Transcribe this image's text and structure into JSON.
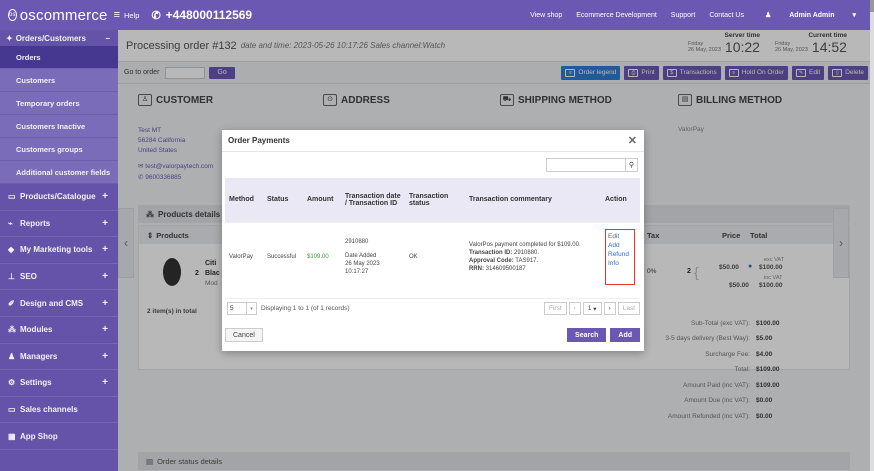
{
  "topbar": {
    "logo": "oscommerce",
    "help": "Help",
    "phone": "+448000112569",
    "links": [
      "View shop",
      "Ecommerce Development",
      "Support",
      "Contact Us"
    ],
    "admin": "Admin Admin"
  },
  "sidebar": {
    "section": "Orders/Customers",
    "sub_items": [
      {
        "label": "Orders",
        "active": true
      },
      {
        "label": "Customers",
        "active": false
      },
      {
        "label": "Temporary orders",
        "active": false
      },
      {
        "label": "Customers Inactive",
        "active": false
      },
      {
        "label": "Customers groups",
        "active": false
      },
      {
        "label": "Additional customer fields",
        "active": false
      }
    ],
    "main_items": [
      {
        "label": "Products/Catalogue",
        "icon": "catalogue-icon"
      },
      {
        "label": "Reports",
        "icon": "chart-icon"
      },
      {
        "label": "My Marketing tools",
        "icon": "marketing-icon"
      },
      {
        "label": "SEO",
        "icon": "seo-icon"
      },
      {
        "label": "Design and CMS",
        "icon": "brush-icon"
      },
      {
        "label": "Modules",
        "icon": "modules-icon"
      },
      {
        "label": "Managers",
        "icon": "managers-icon"
      },
      {
        "label": "Settings",
        "icon": "settings-icon"
      },
      {
        "label": "Sales channels",
        "icon": "sales-icon"
      },
      {
        "label": "App Shop",
        "icon": "app-shop-icon"
      }
    ]
  },
  "header": {
    "title": "Processing order #132",
    "subtitle": "date and time: 2023-05-26 10:17:26  Sales channel:Watch",
    "server_label": "Server time",
    "server_day": "Friday",
    "server_date": "26 May, 2023",
    "server_time": "10:22",
    "current_label": "Current time",
    "current_day": "Friday",
    "current_date": "26 May, 2023",
    "current_time": "14:52"
  },
  "toolbar": {
    "go_label": "Go to order",
    "go_button": "Go",
    "buttons": [
      "Order legend",
      "Print",
      "Transactions",
      "Hold On Order",
      "Edit",
      "Delete"
    ]
  },
  "sections": {
    "customer": "CUSTOMER",
    "address": "ADDRESS",
    "shipping": "SHIPPING METHOD",
    "billing": "BILLING METHOD",
    "billing_value": "ValorPay",
    "customer_lines": [
      "Test MT",
      "56284 California",
      "United States",
      "test@valorpaytech.com",
      "9600336885"
    ]
  },
  "products": {
    "panel_title": "Products details",
    "header": "Products",
    "tax_header": "Tax",
    "price_header": "Price",
    "total_header": "Total",
    "product_short": "Citi",
    "qty": "2",
    "qty_name": "Blac",
    "model": "Mod",
    "tax": "0%",
    "qty_right": "2",
    "exc_vat_label": "exc VAT",
    "exc_price": "$50.00",
    "exc_total": "$100.00",
    "inc_vat_label": "inc VAT",
    "inc_price": "$50.00",
    "inc_total": "$100.00",
    "items_total": "2 item(s) in total"
  },
  "totals": [
    {
      "label": "Sub-Total (exc VAT):",
      "value": "$100.00"
    },
    {
      "label": "3-5 days delivery (Best Way):",
      "value": "$5.00"
    },
    {
      "label": "Surcharge Fee:",
      "value": "$4.00"
    },
    {
      "label": "Total:",
      "value": "$109.00"
    },
    {
      "label": "Amount Paid (inc VAT):",
      "value": "$109.00"
    },
    {
      "label": "Amount Due (inc VAT):",
      "value": "$0.00"
    },
    {
      "label": "Amount Refunded (inc VAT):",
      "value": "$0.00"
    }
  ],
  "status_panel": "Order status details",
  "modal": {
    "title": "Order Payments",
    "columns": [
      "Method",
      "Status",
      "Amount",
      "Transaction date / Transaction ID",
      "Transaction status",
      "Transaction commentary",
      "Action"
    ],
    "row": {
      "method": "ValorPay",
      "status": "Successful",
      "amount": "$109.00",
      "txn_id": "2910880",
      "date_label": "Date Added",
      "date_value": "26 May 2023",
      "time_value": "10:17:27",
      "txn_status": "OK",
      "comment_1": "ValorPos payment completed for $109.00.",
      "comment_2_label": "Transaction ID:",
      "comment_2_value": "2910880.",
      "comment_3_label": "Approval Code:",
      "comment_3_value": "TAS917.",
      "comment_4_label": "RRN:",
      "comment_4_value": "314609500187",
      "actions": [
        "Edit",
        "Add",
        "Refund",
        "Info"
      ]
    },
    "per_page": "5",
    "displaying": "Displaying 1 to 1 (of 1 records)",
    "first": "First",
    "page": "1",
    "last": "Last",
    "cancel": "Cancel",
    "search": "Search",
    "add": "Add"
  }
}
